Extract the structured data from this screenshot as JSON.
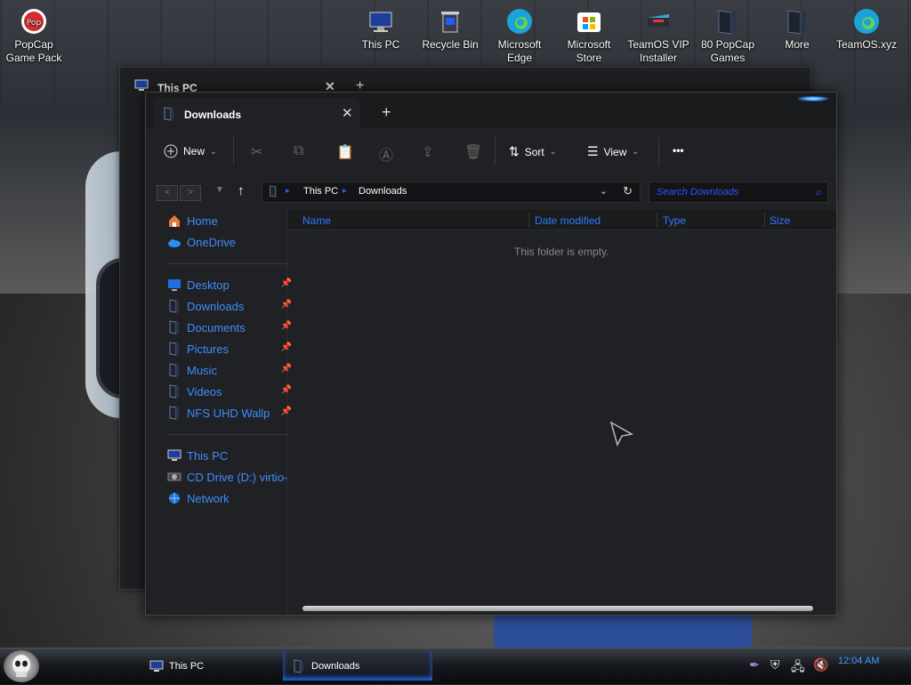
{
  "desktop": {
    "icons": [
      {
        "label_line1": "PopCap",
        "label_line2": "Game Pack",
        "icon": "popcap-icon"
      },
      {
        "label_line1": "This PC",
        "label_line2": "",
        "icon": "this-pc-icon"
      },
      {
        "label_line1": "Recycle Bin",
        "label_line2": "",
        "icon": "recycle-bin-icon"
      },
      {
        "label_line1": "Microsoft",
        "label_line2": "Edge",
        "icon": "edge-icon"
      },
      {
        "label_line1": "Microsoft",
        "label_line2": "Store",
        "icon": "store-icon"
      },
      {
        "label_line1": "TeamOS VIP",
        "label_line2": "Installer",
        "icon": "installer-icon"
      },
      {
        "label_line1": "80 PopCap",
        "label_line2": "Games",
        "icon": "games-folder-icon"
      },
      {
        "label_line1": "More",
        "label_line2": "",
        "icon": "folder-icon"
      },
      {
        "label_line1": "TeamOS.xyz",
        "label_line2": "",
        "icon": "edge-icon"
      }
    ]
  },
  "background_window": {
    "tab_title": "This PC",
    "close": "✕",
    "new_tab": "+"
  },
  "window": {
    "tab_title": "Downloads",
    "close": "✕",
    "new_tab": "+",
    "toolbar": {
      "new_label": "New",
      "sort_label": "Sort",
      "view_label": "View",
      "more_label": "•••"
    },
    "address": {
      "crumbs": [
        "This PC",
        "Downloads"
      ],
      "search_placeholder": "Search Downloads"
    },
    "nav": {
      "quick": [
        {
          "label": "Home",
          "icon": "home-icon"
        },
        {
          "label": "OneDrive",
          "icon": "cloud-icon"
        }
      ],
      "pinned": [
        {
          "label": "Desktop",
          "icon": "desktop-icon"
        },
        {
          "label": "Downloads",
          "icon": "downloads-icon"
        },
        {
          "label": "Documents",
          "icon": "documents-icon"
        },
        {
          "label": "Pictures",
          "icon": "pictures-icon"
        },
        {
          "label": "Music",
          "icon": "music-icon"
        },
        {
          "label": "Videos",
          "icon": "videos-icon"
        },
        {
          "label": "NFS UHD Wallp",
          "icon": "folder-icon"
        }
      ],
      "devices": [
        {
          "label": "This PC",
          "icon": "this-pc-icon"
        },
        {
          "label": "CD Drive (D:) virtio-",
          "icon": "cd-drive-icon"
        },
        {
          "label": "Network",
          "icon": "network-icon"
        }
      ]
    },
    "columns": [
      "Name",
      "Date modified",
      "Type",
      "Size"
    ],
    "empty_message": "This folder is empty."
  },
  "taskbar": {
    "buttons": [
      {
        "label": "This PC",
        "active": false
      },
      {
        "label": "Downloads",
        "active": true
      }
    ],
    "clock": "12:04 AM"
  },
  "colors": {
    "accent": "#2f7bff",
    "window_bg": "#202124"
  }
}
